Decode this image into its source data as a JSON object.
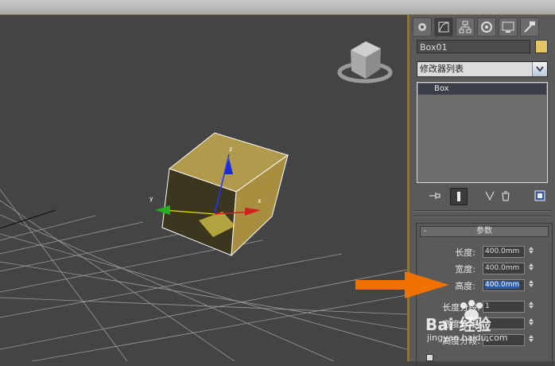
{
  "colors": {
    "accent": "#e8a317",
    "object_color": "#e5c463",
    "selection": "#2c5ba8",
    "annotation_arrow": "#f07000"
  },
  "command_panel": {
    "tabs": [
      {
        "icon": "create-icon"
      },
      {
        "icon": "modify-icon"
      },
      {
        "icon": "hierarchy-icon"
      },
      {
        "icon": "motion-icon"
      },
      {
        "icon": "display-icon"
      },
      {
        "icon": "utilities-icon"
      }
    ],
    "object_name": "Box01",
    "modifier_list_label": "修改器列表",
    "stack_items": [
      "Box"
    ],
    "parameters": {
      "header": "参数",
      "collapse_glyph": "-",
      "length_label": "长度:",
      "length_value": "400.0mm",
      "width_label": "宽度:",
      "width_value": "400.0mm",
      "height_label": "高度:",
      "height_value": "400.0mm",
      "length_segs_label": "长度分段:",
      "length_segs_value": "1",
      "width_segs_label": "宽度分段:",
      "width_segs_value": "1",
      "height_segs_label": "高度分段:",
      "height_segs_value": "1"
    }
  },
  "viewport": {
    "axis_labels": {
      "x": "x",
      "y": "y",
      "z": "z"
    }
  },
  "watermark": {
    "brand": "Bai 经验",
    "url": "jingyan.baidu.com"
  }
}
